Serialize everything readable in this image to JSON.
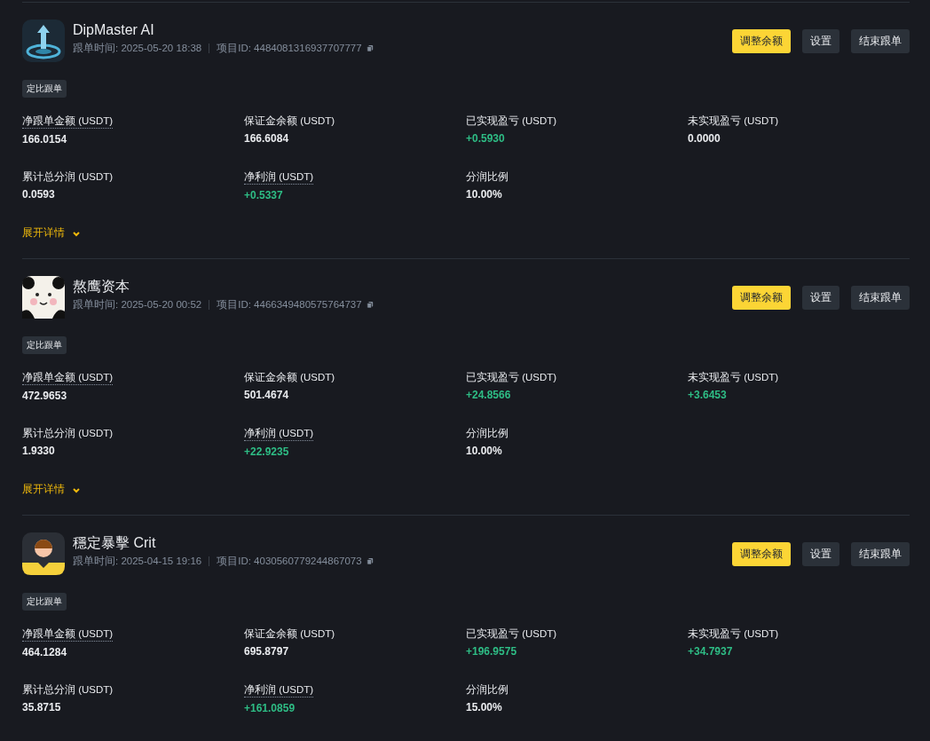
{
  "cards": [
    {
      "avatar": {
        "kind": "arrow"
      },
      "name": "DipMaster AI",
      "follow_time": "跟单时间: 2025-05-20 18:38",
      "project_id": "项目ID: 4484081316937707777",
      "buttons": [
        {
          "label": "调整余额",
          "primary": true
        },
        {
          "label": "设置",
          "primary": false
        },
        {
          "label": "结束跟单",
          "primary": false
        }
      ],
      "tag": "定比跟单",
      "metrics": [
        {
          "label": "净跟单金额 (USDT)",
          "value": "166.0154",
          "underlined": true,
          "positive": false
        },
        {
          "label": "保证金余额 (USDT)",
          "value": "166.6084",
          "underlined": false,
          "positive": false
        },
        {
          "label": "已实现盈亏 (USDT)",
          "value": "+0.5930",
          "underlined": false,
          "positive": true
        },
        {
          "label": "未实现盈亏 (USDT)",
          "value": "0.0000",
          "underlined": false,
          "positive": false
        },
        {
          "label": "累计总分润 (USDT)",
          "value": "0.0593",
          "underlined": false,
          "positive": false
        },
        {
          "label": "净利润 (USDT)",
          "value": "+0.5337",
          "underlined": true,
          "positive": true
        },
        {
          "label": "分润比例",
          "value": "10.00%",
          "underlined": false,
          "positive": false
        }
      ],
      "expand": "展开详情"
    },
    {
      "avatar": {
        "kind": "panda"
      },
      "name": "熬鹰资本",
      "follow_time": "跟单时间: 2025-05-20 00:52",
      "project_id": "项目ID: 4466349480575764737",
      "buttons": [
        {
          "label": "调整余额",
          "primary": true
        },
        {
          "label": "设置",
          "primary": false
        },
        {
          "label": "结束跟单",
          "primary": false
        }
      ],
      "tag": "定比跟单",
      "metrics": [
        {
          "label": "净跟单金额 (USDT)",
          "value": "472.9653",
          "underlined": true,
          "positive": false
        },
        {
          "label": "保证金余额 (USDT)",
          "value": "501.4674",
          "underlined": false,
          "positive": false
        },
        {
          "label": "已实现盈亏 (USDT)",
          "value": "+24.8566",
          "underlined": false,
          "positive": true
        },
        {
          "label": "未实现盈亏 (USDT)",
          "value": "+3.6453",
          "underlined": false,
          "positive": true
        },
        {
          "label": "累计总分润 (USDT)",
          "value": "1.9330",
          "underlined": false,
          "positive": false
        },
        {
          "label": "净利润 (USDT)",
          "value": "+22.9235",
          "underlined": true,
          "positive": true
        },
        {
          "label": "分润比例",
          "value": "10.00%",
          "underlined": false,
          "positive": false
        }
      ],
      "expand": "展开详情"
    },
    {
      "avatar": {
        "kind": "person"
      },
      "name": "穩定暴擊 Crit",
      "follow_time": "跟单时间: 2025-04-15 19:16",
      "project_id": "项目ID: 4030560779244867073",
      "buttons": [
        {
          "label": "调整余额",
          "primary": true
        },
        {
          "label": "设置",
          "primary": false
        },
        {
          "label": "结束跟单",
          "primary": false
        }
      ],
      "tag": "定比跟单",
      "metrics": [
        {
          "label": "净跟单金额 (USDT)",
          "value": "464.1284",
          "underlined": true,
          "positive": false
        },
        {
          "label": "保证金余额 (USDT)",
          "value": "695.8797",
          "underlined": false,
          "positive": false
        },
        {
          "label": "已实现盈亏 (USDT)",
          "value": "+196.9575",
          "underlined": false,
          "positive": true
        },
        {
          "label": "未实现盈亏 (USDT)",
          "value": "+34.7937",
          "underlined": false,
          "positive": true
        },
        {
          "label": "累计总分润 (USDT)",
          "value": "35.8715",
          "underlined": false,
          "positive": false
        },
        {
          "label": "净利润 (USDT)",
          "value": "+161.0859",
          "underlined": true,
          "positive": true
        },
        {
          "label": "分润比例",
          "value": "15.00%",
          "underlined": false,
          "positive": false
        }
      ]
    }
  ]
}
